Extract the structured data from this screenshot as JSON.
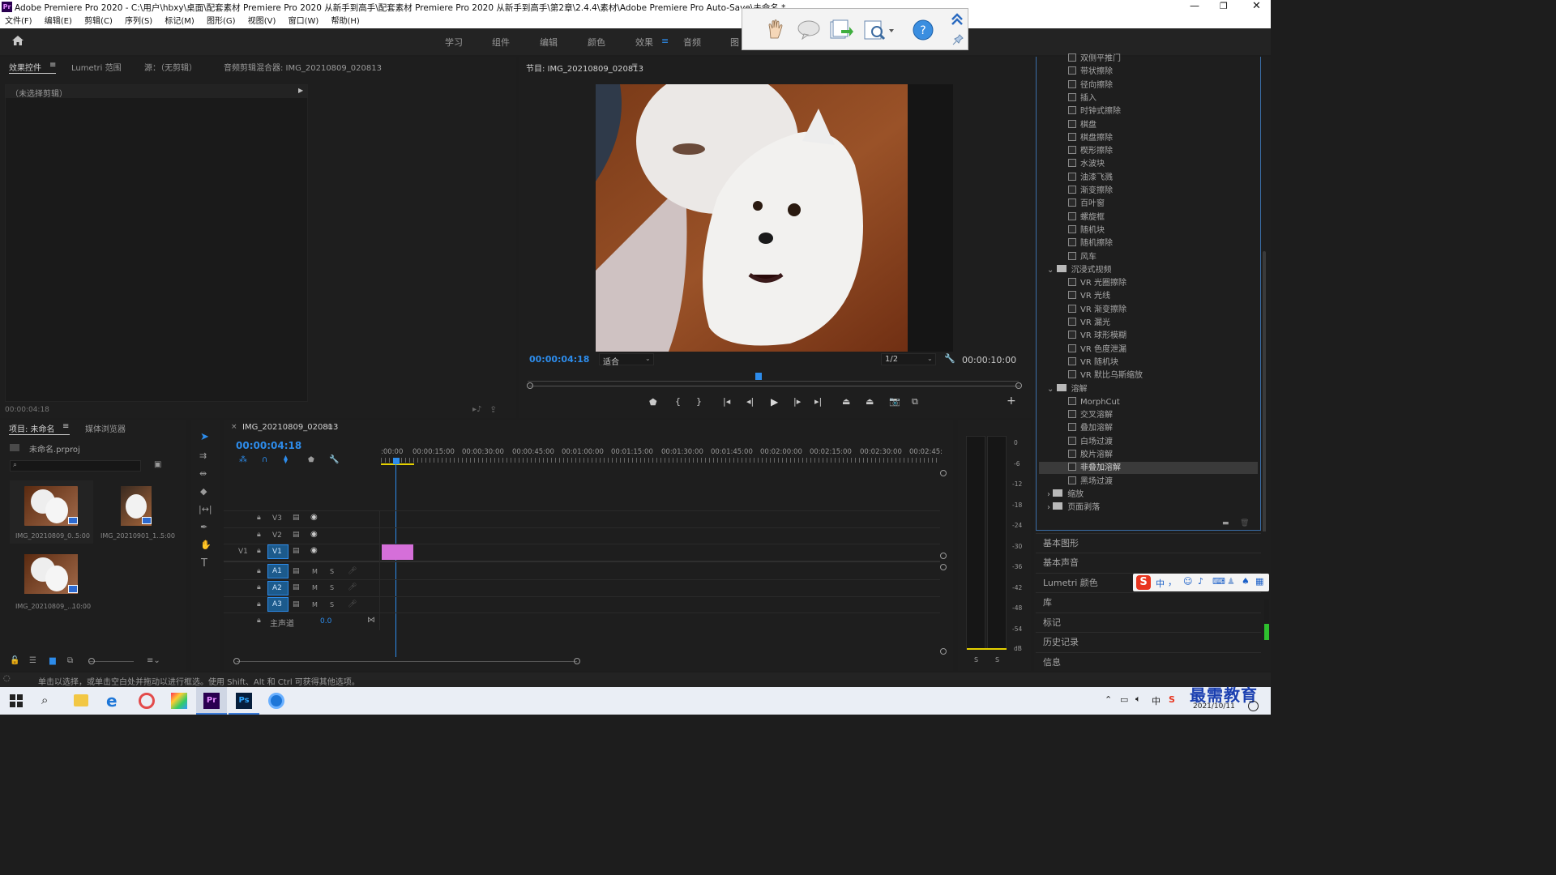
{
  "window": {
    "title": "Adobe Premiere Pro 2020 - C:\\用户\\hbxy\\桌面\\配套素材 Premiere Pro 2020 从新手到高手\\配套素材 Premiere Pro 2020 从新手到高手\\第2章\\2.4.4\\素材\\Adobe Premiere Pro Auto-Save\\未命名 *",
    "app_icon": "Pr"
  },
  "menu": [
    "文件(F)",
    "编辑(E)",
    "剪辑(C)",
    "序列(S)",
    "标记(M)",
    "图形(G)",
    "视图(V)",
    "窗口(W)",
    "帮助(H)"
  ],
  "workspaces": [
    "学习",
    "组件",
    "编辑",
    "颜色",
    "效果",
    "音频",
    "图"
  ],
  "active_workspace": "效果",
  "top_left_panel": {
    "tabs": [
      "效果控件",
      "Lumetri 范围",
      "源：（无剪辑）",
      "音频剪辑混合器: IMG_20210809_020813"
    ],
    "no_clip": "（未选择剪辑）",
    "timecode": "00:00:04:18"
  },
  "program_monitor": {
    "title": "节目: IMG_20210809_020813",
    "timecode": "00:00:04:18",
    "fit": "适合",
    "resolution": "1/2",
    "duration": "00:00:10:00"
  },
  "project_panel": {
    "tabs": [
      "项目: 未命名",
      "媒体浏览器"
    ],
    "project_file": "未命名.prproj",
    "items": [
      {
        "name": "IMG_20210809_0...",
        "duration": "5:00"
      },
      {
        "name": "IMG_20210901_1...",
        "duration": "5:00"
      },
      {
        "name": "IMG_20210809_...",
        "duration": "10:00"
      }
    ]
  },
  "timeline": {
    "sequence_name": "IMG_20210809_020813",
    "timecode": "00:00:04:18",
    "ruler": [
      ":00:00",
      "00:00:15:00",
      "00:00:30:00",
      "00:00:45:00",
      "00:01:00:00",
      "00:01:15:00",
      "00:01:30:00",
      "00:01:45:00",
      "00:02:00:00",
      "00:02:15:00",
      "00:02:30:00",
      "00:02:45:"
    ],
    "video_tracks": [
      "V3",
      "V2",
      "V1"
    ],
    "audio_tracks": [
      "A1",
      "A2",
      "A3"
    ],
    "v1_source_label": "V1",
    "master": "主声道",
    "master_value": "0.0",
    "track_toggles": [
      "M",
      "S"
    ]
  },
  "audio_meter": {
    "scale": [
      "0",
      "-6",
      "-12",
      "-18",
      "-24",
      "-30",
      "-36",
      "-42",
      "-48",
      "-54",
      "dB"
    ],
    "solo": [
      "S",
      "S"
    ]
  },
  "effects_list": {
    "wipe_items": [
      "双侧平推门",
      "带状擦除",
      "径向擦除",
      "插入",
      "时钟式擦除",
      "棋盘",
      "棋盘擦除",
      "楔形擦除",
      "水波块",
      "油漆飞溅",
      "渐变擦除",
      "百叶窗",
      "螺旋框",
      "随机块",
      "随机擦除",
      "风车"
    ],
    "immersive_folder": "沉浸式视频",
    "immersive_items": [
      "VR 光圈擦除",
      "VR 光线",
      "VR 渐变擦除",
      "VR 漏光",
      "VR 球形模糊",
      "VR 色度泄漏",
      "VR 随机块",
      "VR 默比乌斯缩放"
    ],
    "dissolve_folder": "溶解",
    "dissolve_items": [
      "MorphCut",
      "交叉溶解",
      "叠加溶解",
      "白场过渡",
      "胶片溶解",
      "非叠加溶解",
      "黑场过渡"
    ],
    "selected_item": "非叠加溶解",
    "folders_after": [
      "缩放",
      "页面剥落"
    ]
  },
  "right_sections": [
    "基本图形",
    "基本声音",
    "Lumetri 颜色",
    "库",
    "标记",
    "历史记录",
    "信息"
  ],
  "status_bar": "单击以选择，或单击空白处并拖动以进行框选。使用 Shift、Alt 和 Ctrl 可获得其他选项。",
  "ime_bar": [
    "中",
    "，"
  ],
  "watermark": "最需教育",
  "taskbar": {
    "date": "2021/10/11",
    "apps": [
      "windows-start",
      "search",
      "file-explorer",
      "edge",
      "snipping",
      "photos",
      "premiere",
      "photoshop",
      "tablet"
    ],
    "pr_label": "Pr",
    "ps_label": "Ps"
  },
  "colors": {
    "accent_blue": "#2d8ceb",
    "clip_pink": "#d56fd9",
    "playhead_blue": "#2d8ceb",
    "track_target_blue": "#1c5a8c"
  }
}
